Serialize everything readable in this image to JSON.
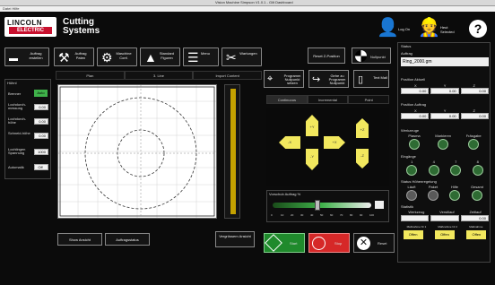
{
  "window": {
    "title": "Vision Machine Simpson V1.0.1 - Gilt Dashboard",
    "menu": "Datei Hilfe"
  },
  "brand": {
    "logo_line1": "LINCOLN",
    "logo_line2": "ELECTRIC",
    "app_title_1": "Cutting",
    "app_title_2": "Systems"
  },
  "toolbar": {
    "btn1": "Auftrag erstellen",
    "btn2": "Auftrag Paten",
    "btn3": "Maschine Conf.",
    "btn4": "Standard Figuren",
    "btn5": "Menu",
    "btn6": "Wartungen"
  },
  "user": {
    "logon": "Log On",
    "userinfo": "Heut Selected",
    "help": "?"
  },
  "left": {
    "title": "Hühnl",
    "brenner": "Brenner",
    "brenner_value": "Auto",
    "r1_label": "Lochdurch-messung",
    "r1_val": "0.00",
    "r2_label": "Lochdurch-höhe",
    "r2_val": "0.00",
    "r3_label": "Schneid-höhe",
    "r3_val": "0.00",
    "r4_label": "Lochlingen Spannung",
    "r4_val": "1000",
    "auto_label": "Automatik",
    "auto_val": "Off"
  },
  "view_tabs": [
    "Plan",
    "3. Line",
    "Import Content"
  ],
  "plot_buttons": {
    "b1": "Show Ansicht",
    "b2": "Auftragsstatus",
    "b3": "Vergrössern Ansicht"
  },
  "center_top": {
    "reset": "Reset Z-Position",
    "nullpunkt": "Nullpunkt"
  },
  "programs": {
    "p1": "Programm Nullpunkt setzen",
    "p2": "Gehe zu Programm Nullpunkt",
    "p3": "Text Mail"
  },
  "move_tabs": [
    "Continuous",
    "Incremental",
    "Point"
  ],
  "speed": {
    "label": "Vorschub Auftrag %",
    "scale": [
      "0",
      "10",
      "20",
      "30",
      "40",
      "50",
      "60",
      "70",
      "80",
      "90",
      "100"
    ],
    "value_pct": 45
  },
  "actions": {
    "start": "Start",
    "stop": "Stop",
    "reset": "Reset"
  },
  "status": {
    "title": "Status",
    "auftrag_label": "Auftrag",
    "auftrag_value": "Ring_2000.gm",
    "pos_actual_label": "Position Aktuell",
    "pos_axes": [
      "X",
      "Y",
      "Z"
    ],
    "pos_actual_values": [
      "0.00",
      "0.00",
      "0.00"
    ],
    "pos_target_label": "Position Auftrag",
    "pos_target_values": [
      "0.00",
      "0.00",
      "0.00"
    ],
    "werkzeuge_label": "Werkzeuge",
    "werkzeuge": [
      "Plasma",
      "Markieren",
      "Fräsgabe"
    ],
    "eingaenge_label": "Eingänge",
    "eingaenge": [
      "1",
      "4",
      "7",
      "8"
    ],
    "status_label": "Status Höhenregelung",
    "status_items": [
      "Läuft",
      "Paket",
      "Hilfe",
      "Gesamt"
    ],
    "statistik_label": "Statistik",
    "stat_cols": [
      "Werkzeug",
      "Verstllauf",
      "Zeitlauf"
    ],
    "stat_vals": [
      "",
      "",
      "0.00"
    ],
    "bottom_cols": [
      "Maßnahme Nr 1",
      "Maßnahme Nr 2",
      "Maßnahme"
    ],
    "bottom_vals": [
      "Offen",
      "Offen",
      "Offen"
    ]
  },
  "colors": {
    "accent_green": "#3fb24a",
    "accent_yellow": "#f2e85e",
    "stop_red": "#d62828"
  }
}
